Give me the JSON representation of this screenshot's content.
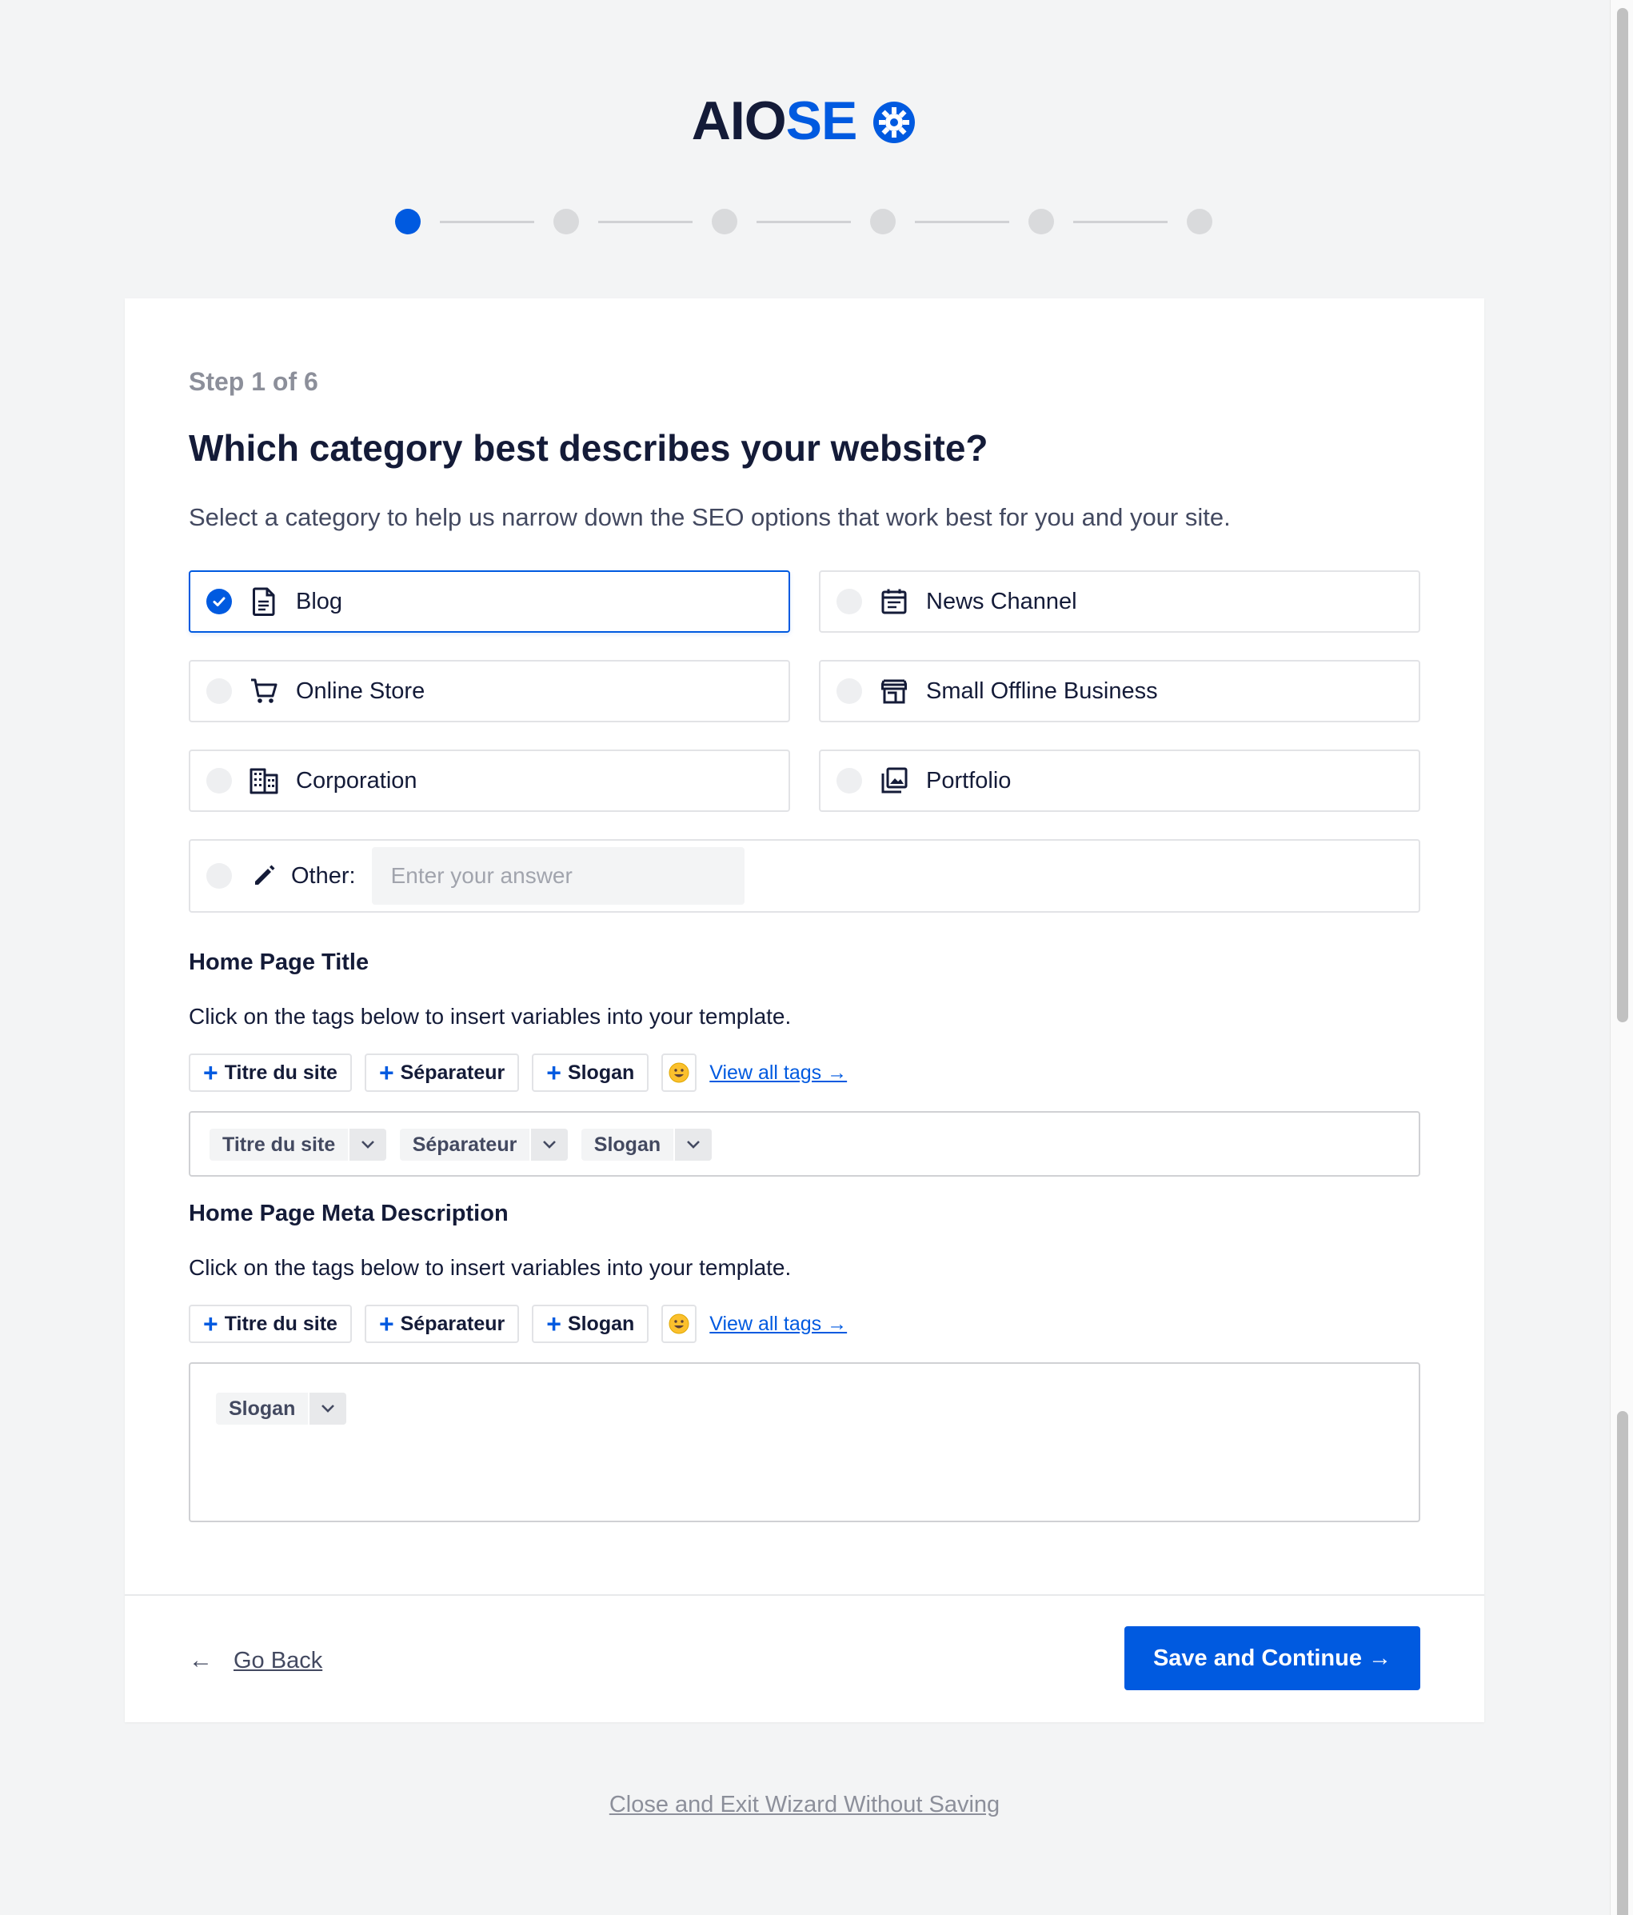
{
  "logo": {
    "part1": "AIO",
    "part2": "SEO"
  },
  "stepper": {
    "total": 6,
    "current": 1
  },
  "step_label": "Step 1 of 6",
  "title": "Which category best describes your website?",
  "subtitle": "Select a category to help us narrow down the SEO options that work best for you and your site.",
  "categories": [
    {
      "label": "Blog",
      "icon": "document-icon",
      "selected": true
    },
    {
      "label": "News Channel",
      "icon": "calendar-icon",
      "selected": false
    },
    {
      "label": "Online Store",
      "icon": "cart-icon",
      "selected": false
    },
    {
      "label": "Small Offline Business",
      "icon": "store-icon",
      "selected": false
    },
    {
      "label": "Corporation",
      "icon": "building-icon",
      "selected": false
    },
    {
      "label": "Portfolio",
      "icon": "gallery-icon",
      "selected": false
    }
  ],
  "other": {
    "label": "Other:",
    "placeholder": "Enter your answer",
    "value": ""
  },
  "home_title": {
    "label": "Home Page Title",
    "help": "Click on the tags below to insert variables into your template.",
    "tag_buttons": [
      "Titre du site",
      "Séparateur",
      "Slogan"
    ],
    "view_all": "View all tags →",
    "chips": [
      "Titre du site",
      "Séparateur",
      "Slogan"
    ]
  },
  "home_meta": {
    "label": "Home Page Meta Description",
    "help": "Click on the tags below to insert variables into your template.",
    "tag_buttons": [
      "Titre du site",
      "Séparateur",
      "Slogan"
    ],
    "view_all": "View all tags →",
    "chips": [
      "Slogan"
    ]
  },
  "footer": {
    "go_back": "Go Back",
    "save_continue": "Save and Continue →"
  },
  "exit_link": "Close and Exit Wizard Without Saving",
  "colors": {
    "accent": "#005ae0",
    "text": "#141b38",
    "muted": "#8c8f9a",
    "background": "#f3f4f5"
  }
}
